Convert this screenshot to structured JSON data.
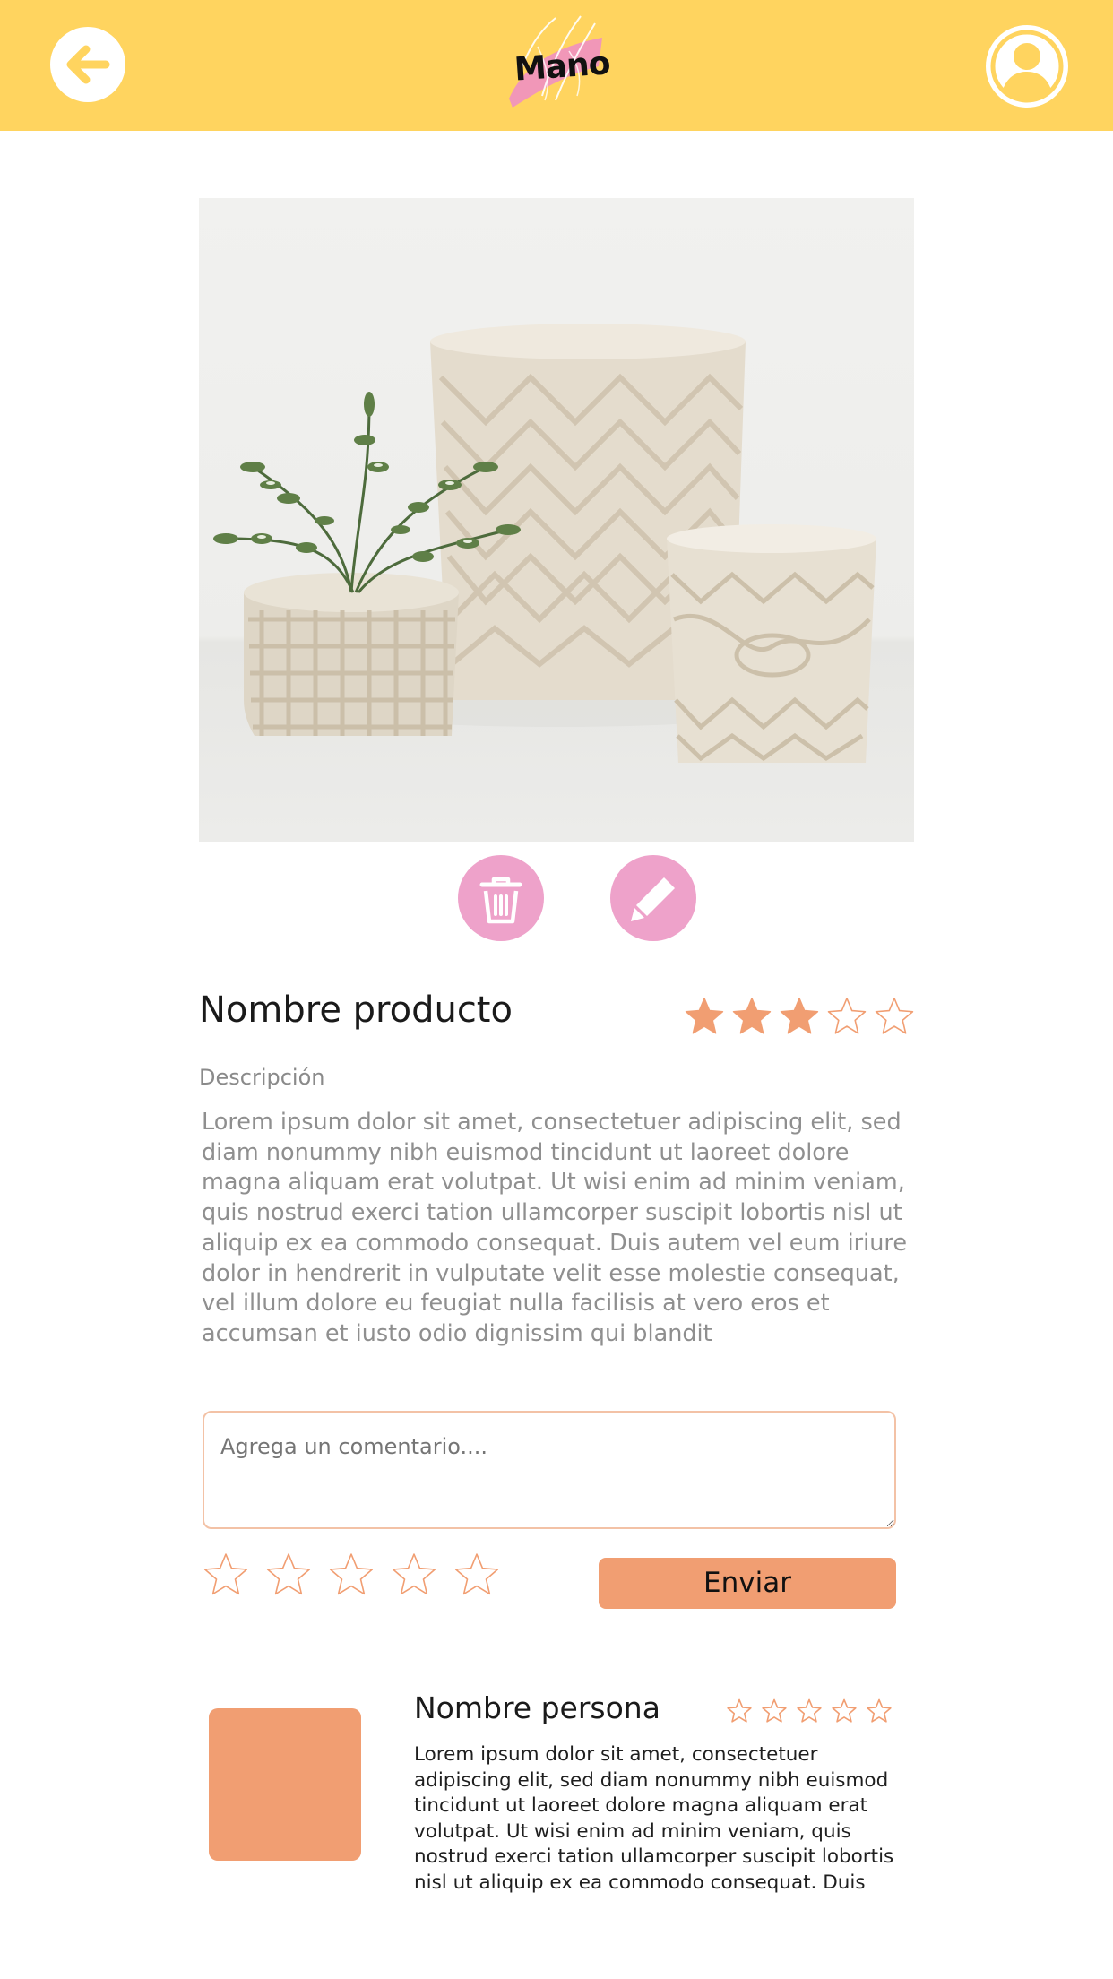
{
  "header": {
    "logo_text": "Mano",
    "background_color": "#ffd45f",
    "back_icon": "arrow-left-icon",
    "profile_icon": "user-icon"
  },
  "product": {
    "name": "Nombre producto",
    "rating": 3,
    "rating_max": 5,
    "description_label": "Descripción",
    "description": "Lorem ipsum dolor sit amet, consectetuer adipiscing elit, sed diam nonummy nibh euismod tincidunt ut laoreet dolore magna aliquam erat volutpat. Ut wisi enim ad minim veniam, quis nostrud exerci tation ullamcorper suscipit lobortis nisl ut aliquip ex ea commodo consequat. Duis autem vel eum iriure dolor in hendrerit in vulputate velit esse molestie consequat, vel illum dolore eu feugiat nulla facilisis at vero eros et accumsan et iusto odio dignissim qui blandit",
    "actions": {
      "delete_icon": "trash-icon",
      "edit_icon": "pencil-icon",
      "button_color": "#eea2ca"
    }
  },
  "comment_form": {
    "placeholder": "Agrega un comentario....",
    "value": "",
    "rating": 0,
    "rating_max": 5,
    "submit_label": "Enviar",
    "accent_color": "#f19e72"
  },
  "reviews": [
    {
      "author": "Nombre persona",
      "rating": 0,
      "rating_max": 5,
      "text": "Lorem ipsum dolor sit amet, consectetuer adipiscing elit, sed diam nonummy nibh euismod tincidunt ut laoreet dolore magna aliquam erat volutpat. Ut wisi enim ad minim veniam, quis nostrud exerci tation ullamcorper suscipit lobortis nisl ut aliquip ex ea commodo consequat. Duis"
    }
  ]
}
